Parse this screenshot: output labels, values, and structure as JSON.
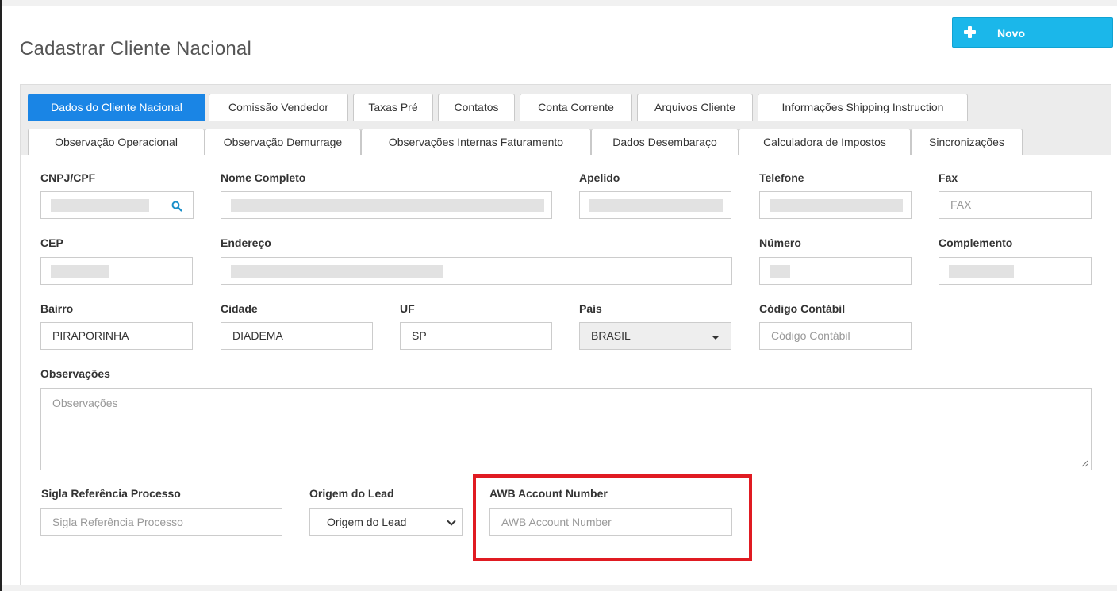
{
  "header": {
    "title": "Cadastrar Cliente Nacional",
    "new_button_label": "Novo",
    "new_button_icon": "plus-icon"
  },
  "tabs_row1": [
    {
      "label": "Dados do Cliente Nacional",
      "active": true
    },
    {
      "label": "Comissão Vendedor"
    },
    {
      "label": "Taxas Pré"
    },
    {
      "label": "Contatos"
    },
    {
      "label": "Conta Corrente"
    },
    {
      "label": "Arquivos Cliente"
    },
    {
      "label": "Informações Shipping Instruction"
    }
  ],
  "tabs_row2": [
    {
      "label": "Observação Operacional"
    },
    {
      "label": "Observação Demurrage"
    },
    {
      "label": "Observações Internas Faturamento"
    },
    {
      "label": "Dados Desembaraço"
    },
    {
      "label": "Calculadora de Impostos"
    },
    {
      "label": "Sincronizações"
    }
  ],
  "form": {
    "cnpj": {
      "label": "CNPJ/CPF",
      "value": "",
      "redacted": true,
      "search_icon": "search-icon"
    },
    "nome": {
      "label": "Nome Completo",
      "value": "",
      "redacted": true
    },
    "apelido": {
      "label": "Apelido",
      "value": "",
      "redacted": true
    },
    "telefone": {
      "label": "Telefone",
      "value": "",
      "redacted": true
    },
    "fax": {
      "label": "Fax",
      "placeholder": "FAX"
    },
    "cep": {
      "label": "CEP",
      "value": "",
      "redacted": true
    },
    "endereco": {
      "label": "Endereço",
      "value": "",
      "redacted": true
    },
    "numero": {
      "label": "Número",
      "value": "",
      "redacted": true
    },
    "complemento": {
      "label": "Complemento",
      "value": "",
      "redacted": true
    },
    "bairro": {
      "label": "Bairro",
      "value": "PIRAPORINHA"
    },
    "cidade": {
      "label": "Cidade",
      "value": "DIADEMA"
    },
    "uf": {
      "label": "UF",
      "value": "SP"
    },
    "pais": {
      "label": "País",
      "value": "BRASIL"
    },
    "codigo_contabil": {
      "label": "Código Contábil",
      "placeholder": "Código Contábil"
    },
    "observacoes": {
      "label": "Observações",
      "placeholder": "Observações"
    },
    "sigla": {
      "label": "Sigla Referência Processo",
      "placeholder": "Sigla Referência Processo"
    },
    "origem_lead": {
      "label": "Origem do Lead",
      "value": "Origem do Lead"
    },
    "awb": {
      "label": "AWB Account Number",
      "placeholder": "AWB Account Number"
    }
  },
  "colors": {
    "accent": "#1bb7ea",
    "active_tab": "#1a85e5",
    "search_icon": "#1a8fc9",
    "highlight": "#e01b22"
  }
}
